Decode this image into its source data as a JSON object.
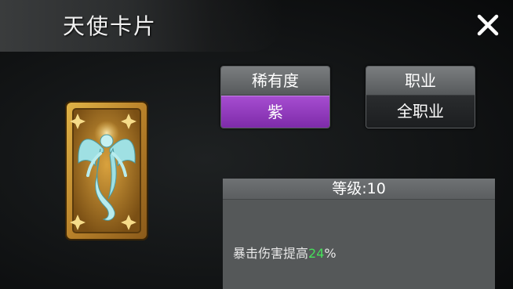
{
  "title": "天使卡片",
  "close_icon": "close-icon",
  "card": {
    "icon": "angel-card-icon",
    "frame_color": "#c9962e",
    "figure_color": "#8fd9dc"
  },
  "rarity": {
    "label": "稀有度",
    "value": "紫",
    "color": "#9b3fcb"
  },
  "job": {
    "label": "职业",
    "value": "全职业"
  },
  "level": {
    "label": "等级",
    "separator": ":",
    "value": "10"
  },
  "effect": {
    "text": "暴击伤害提高",
    "value": "24",
    "unit": "%",
    "value_color": "#46e05a"
  }
}
